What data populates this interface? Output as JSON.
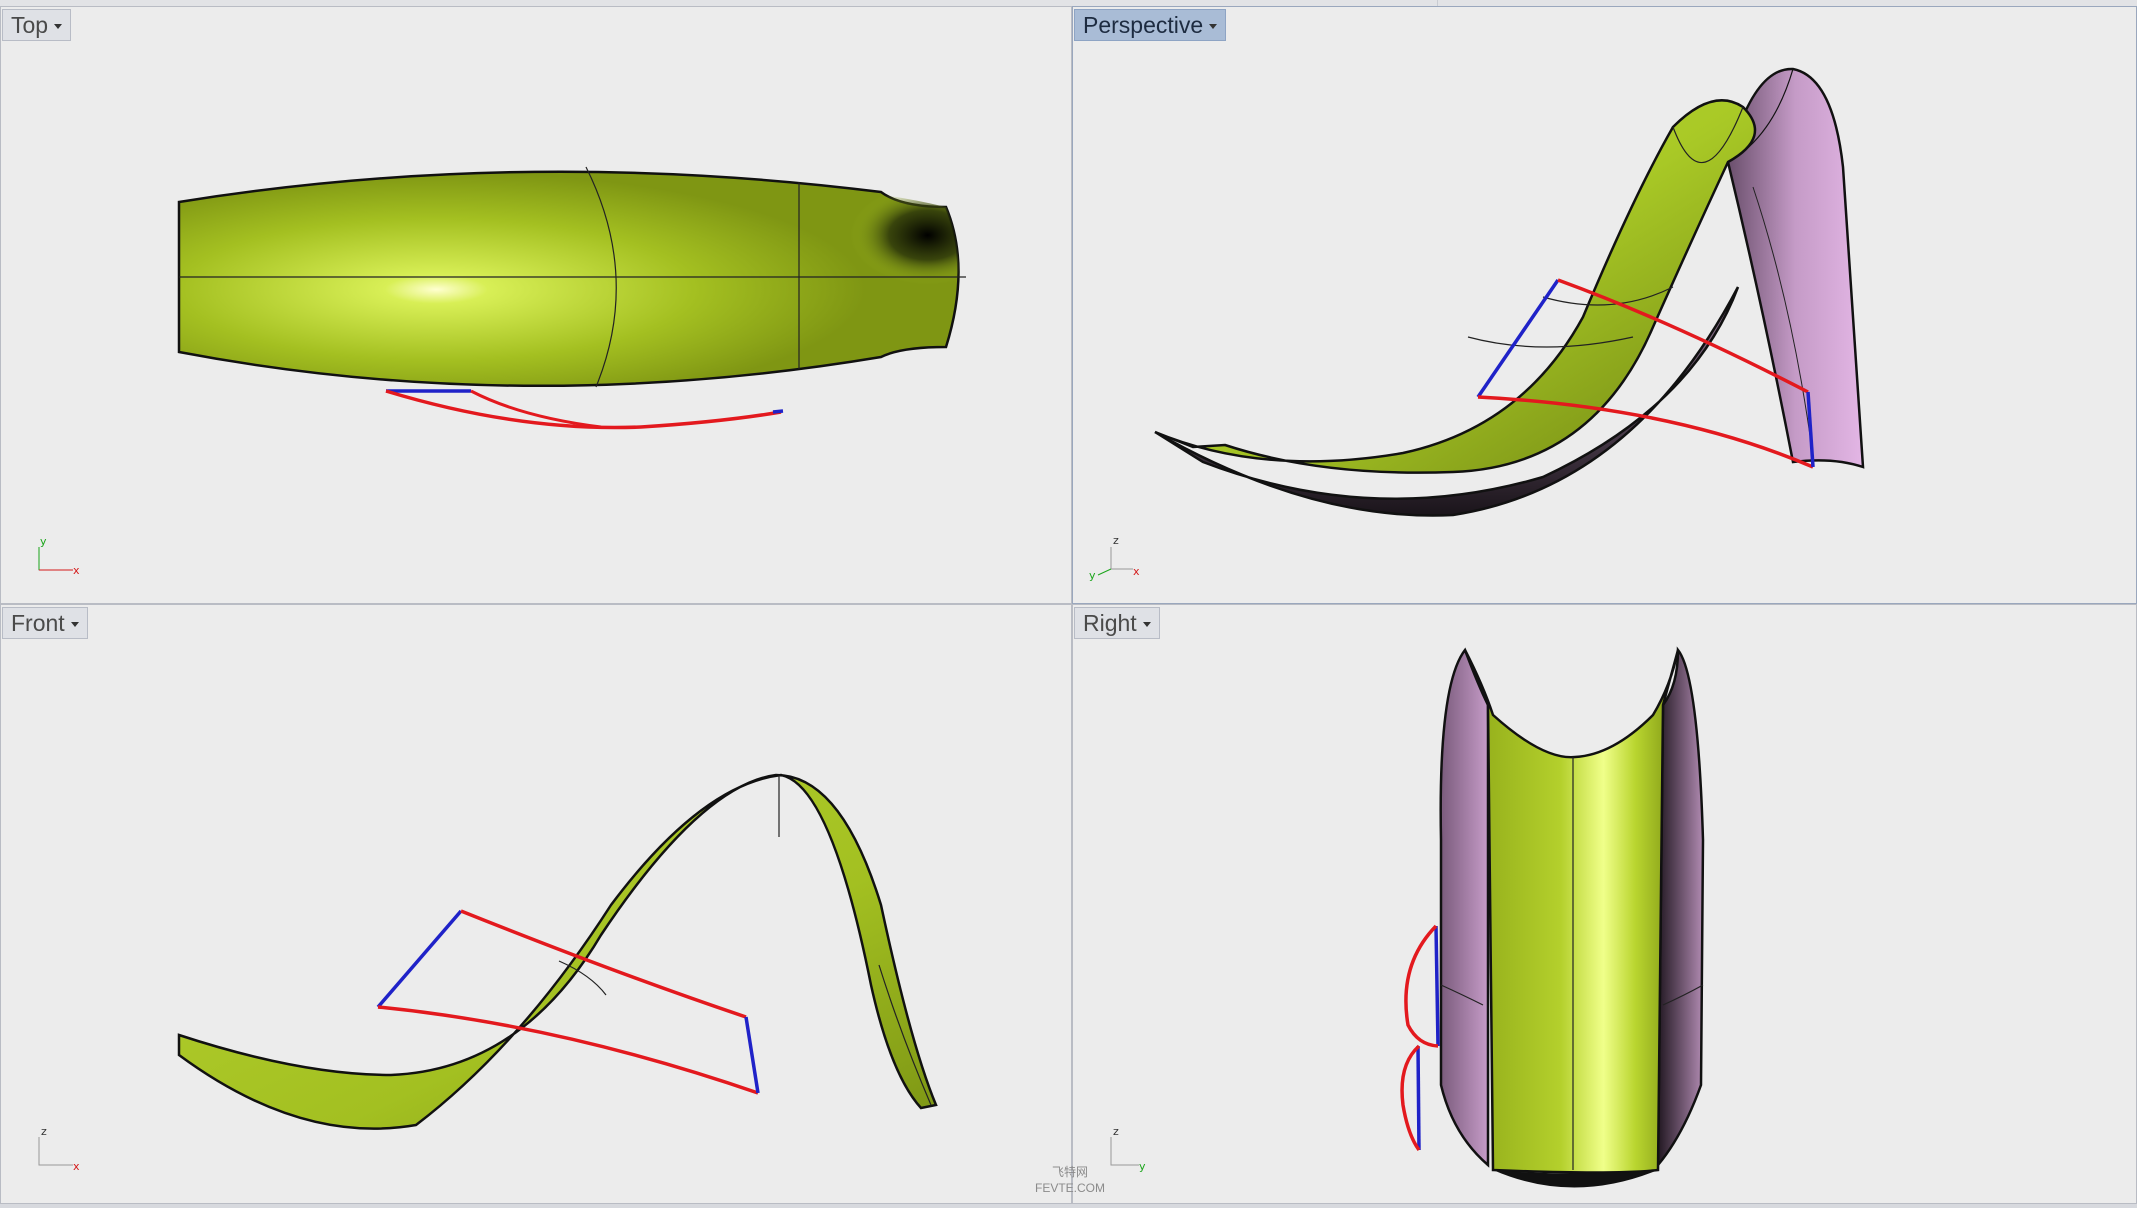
{
  "viewports": {
    "top": {
      "label": "Top",
      "axes": {
        "v": "y",
        "h": "x"
      }
    },
    "perspective": {
      "label": "Perspective",
      "axes": {
        "v": "z",
        "h": "x",
        "d": "y"
      }
    },
    "front": {
      "label": "Front",
      "axes": {
        "v": "z",
        "h": "x"
      }
    },
    "right": {
      "label": "Right",
      "axes": {
        "v": "z",
        "h": "y"
      }
    }
  },
  "active_viewport": "Perspective",
  "watermark": {
    "line1": "飞特网",
    "line2": "FEVTE.COM"
  },
  "colors": {
    "surface_green": "#a9c926",
    "surface_purple": "#c79dc8",
    "curve_red": "#e3191e",
    "curve_blue": "#1f22c8",
    "axis_green": "#1aa51a",
    "axis_red": "#d41a1a"
  }
}
